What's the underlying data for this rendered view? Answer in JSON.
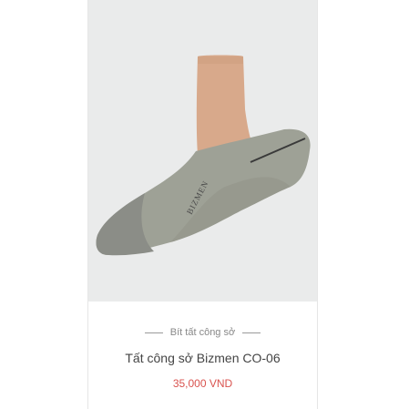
{
  "product": {
    "image_alt": "Gray no-show sock worn on foot",
    "brand_mark": "BIZMEN",
    "category": "Bít tất công sở",
    "title": "Tất công sở Bizmen CO-06",
    "price": "35,000 VND",
    "colors": {
      "background": "#eaebeb",
      "sock": "#9c9f96",
      "toe": "#8a8c87",
      "skin": "#d9a98a",
      "price": "#d9534f"
    }
  }
}
